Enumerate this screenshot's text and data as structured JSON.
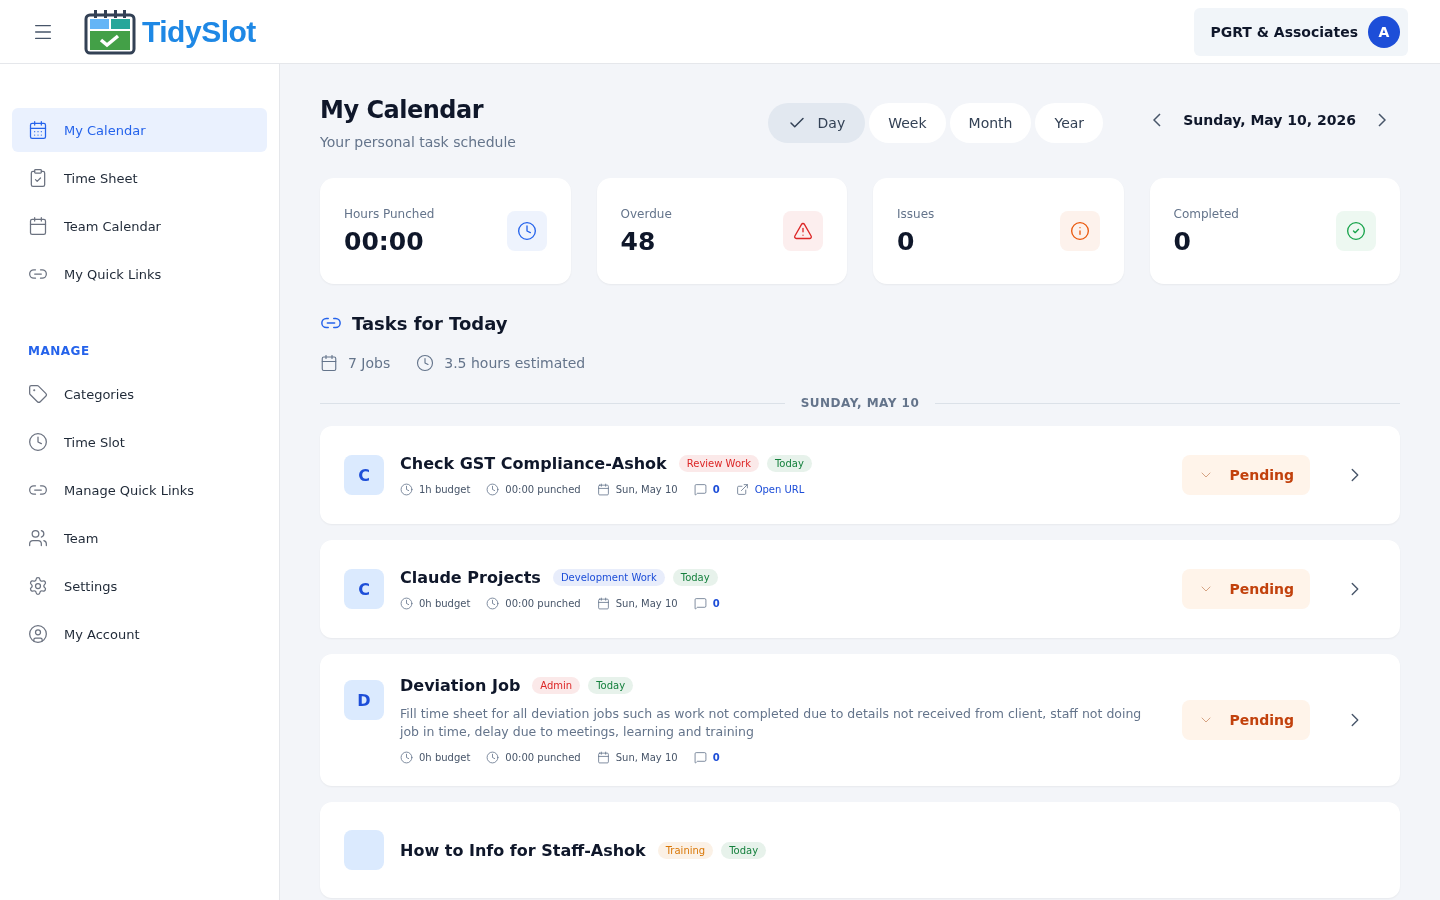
{
  "header": {
    "brand": "TidySlot",
    "org": "PGRT & Associates",
    "avatar": "A"
  },
  "sidebar": {
    "items": [
      {
        "label": "My Calendar",
        "selected": true
      },
      {
        "label": "Time Sheet",
        "selected": false
      },
      {
        "label": "Team Calendar",
        "selected": false
      },
      {
        "label": "My Quick Links",
        "selected": false
      }
    ],
    "section": "MANAGE",
    "manage_items": [
      {
        "label": "Categories",
        "selected": false
      },
      {
        "label": "Time Slot",
        "selected": false
      },
      {
        "label": "Manage Quick Links",
        "selected": false
      },
      {
        "label": "Team",
        "selected": false
      },
      {
        "label": "Settings",
        "selected": false
      },
      {
        "label": "My Account",
        "selected": false
      }
    ]
  },
  "page": {
    "title": "My Calendar",
    "subtitle": "Your personal task schedule"
  },
  "views": [
    {
      "label": "Day",
      "selected": true
    },
    {
      "label": "Week",
      "selected": false
    },
    {
      "label": "Month",
      "selected": false
    },
    {
      "label": "Year",
      "selected": false
    }
  ],
  "date": "Sunday, May 10, 2026",
  "stats": [
    {
      "label": "Hours Punched",
      "value": "00:00",
      "color": "#2563eb"
    },
    {
      "label": "Overdue",
      "value": "48",
      "color": "#dc2626"
    },
    {
      "label": "Issues",
      "value": "0",
      "color": "#ea580c"
    },
    {
      "label": "Completed",
      "value": "0",
      "color": "#16a34a"
    }
  ],
  "tasks": {
    "title": "Tasks for Today",
    "jobs_count": "7 Jobs",
    "estimate": "3.5 hours estimated",
    "day_heading": "SUNDAY, MAY 10"
  },
  "jobs": [
    {
      "initial": "C",
      "title": "Check GST Compliance-Ashok",
      "tags": [
        {
          "label": "Review Work",
          "color": "#dc2626"
        },
        {
          "label": "Today",
          "color": "#15803d"
        }
      ],
      "budget": "1h budget",
      "punched": "00:00 punched",
      "date": "Sun, May 10",
      "comments": "0",
      "link": "Open URL",
      "status": "Pending"
    },
    {
      "initial": "C",
      "title": "Claude Projects",
      "tags": [
        {
          "label": "Development Work",
          "color": "#1d4ed8"
        },
        {
          "label": "Today",
          "color": "#15803d"
        }
      ],
      "budget": "0h budget",
      "punched": "00:00 punched",
      "date": "Sun, May 10",
      "comments": "0",
      "status": "Pending"
    },
    {
      "initial": "D",
      "title": "Deviation Job",
      "tags": [
        {
          "label": "Admin",
          "color": "#dc2626"
        },
        {
          "label": "Today",
          "color": "#15803d"
        }
      ],
      "description": "Fill time sheet for all deviation jobs such as work not completed due to details not received from client, staff not doing job in time, delay due to meetings, learning and training",
      "budget": "0h budget",
      "punched": "00:00 punched",
      "date": "Sun, May 10",
      "comments": "0",
      "status": "Pending"
    },
    {
      "title": "How to Info for Staff-Ashok",
      "tags": [
        {
          "label": "Training",
          "color": "#d97706"
        },
        {
          "label": "Today",
          "color": "#15803d"
        }
      ]
    }
  ]
}
